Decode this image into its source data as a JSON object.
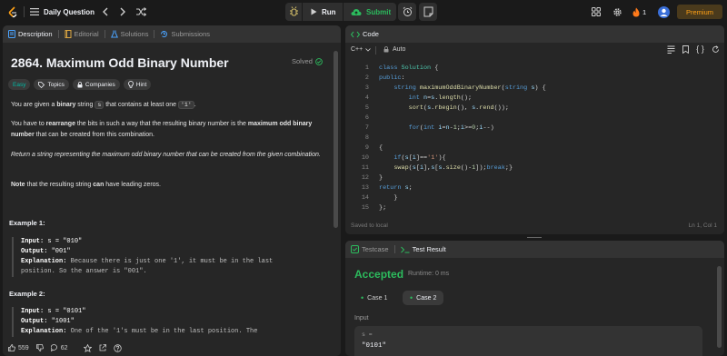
{
  "topbar": {
    "problem_list_label": "Daily Question",
    "run_label": "Run",
    "submit_label": "Submit",
    "streak_count": "1",
    "premium_label": "Premium"
  },
  "description_tabs": [
    {
      "label": "Description",
      "active": true
    },
    {
      "label": "Editorial",
      "active": false
    },
    {
      "label": "Solutions",
      "active": false
    },
    {
      "label": "Submissions",
      "active": false
    }
  ],
  "problem": {
    "title": "2864. Maximum Odd Binary Number",
    "solved_label": "Solved",
    "difficulty": "Easy",
    "topics_label": "Topics",
    "companies_label": "Companies",
    "hint_label": "Hint",
    "p1_a": "You are given a ",
    "p1_b": "binary",
    "p1_c": " string ",
    "p1_code1": "s",
    "p1_d": " that contains at least one ",
    "p1_code2": "'1'",
    "p1_e": ".",
    "p2_a": "You have to ",
    "p2_b": "rearrange",
    "p2_c": " the bits in such a way that the resulting binary number is the ",
    "p2_d": "maximum odd binary number",
    "p2_e": " that can be created from this combination.",
    "p3": "Return a string representing the maximum odd binary number that can be created from the given combination.",
    "p4_a": "Note",
    "p4_b": " that the resulting string ",
    "p4_c": "can",
    "p4_d": " have leading zeros.",
    "example1_title": "Example 1:",
    "example1_input_label": "Input:",
    "example1_input": " s = \"010\"",
    "example1_output_label": "Output:",
    "example1_output": " \"001\"",
    "example1_expl_label": "Explanation:",
    "example1_expl_1": " Because there is just one '1', it must be in the last",
    "example1_expl_2": "position. So the answer is \"001\".",
    "example2_title": "Example 2:",
    "example2_input_label": "Input:",
    "example2_input": " s = \"0101\"",
    "example2_output_label": "Output:",
    "example2_output": " \"1001\"",
    "example2_expl_label": "Explanation:",
    "example2_expl_1": " One of the '1's must be in the last position. The"
  },
  "footer": {
    "likes": "559",
    "comments": "62"
  },
  "code_pane": {
    "title": "Code",
    "language": "C++",
    "autosave": "Auto",
    "saved_status": "Saved to local",
    "cursor_pos": "Ln 1, Col 1",
    "lines": [
      {
        "n": "1",
        "text": "class Solution {"
      },
      {
        "n": "2",
        "text": "public:"
      },
      {
        "n": "3",
        "text": "    string maximumOddBinaryNumber(string s) {"
      },
      {
        "n": "4",
        "text": "        int n=s.length();"
      },
      {
        "n": "5",
        "text": "        sort(s.rbegin(), s.rend());"
      },
      {
        "n": "6",
        "text": ""
      },
      {
        "n": "7",
        "text": "        for(int i=n-1;i>=0;i--)"
      },
      {
        "n": "8",
        "text": ""
      },
      {
        "n": "9",
        "text": "{"
      },
      {
        "n": "10",
        "text": "    if(s[i]=='1'){"
      },
      {
        "n": "11",
        "text": "    swap(s[i],s[s.size()-1]);break;}"
      },
      {
        "n": "12",
        "text": "}"
      },
      {
        "n": "13",
        "text": "return s;"
      },
      {
        "n": "14",
        "text": "    }"
      },
      {
        "n": "15",
        "text": "};"
      }
    ]
  },
  "result_pane": {
    "testcase_tab": "Testcase",
    "result_tab": "Test Result",
    "status": "Accepted",
    "runtime": "Runtime: 0 ms",
    "case1_label": "Case 1",
    "case2_label": "Case 2",
    "input_label": "Input",
    "var_name": "s =",
    "var_value": "\"0101\""
  },
  "colors": {
    "accent_green": "#2cbb5d",
    "easy": "#00b8a3",
    "premium": "#ffa116",
    "streak": "#ff7a1a"
  }
}
